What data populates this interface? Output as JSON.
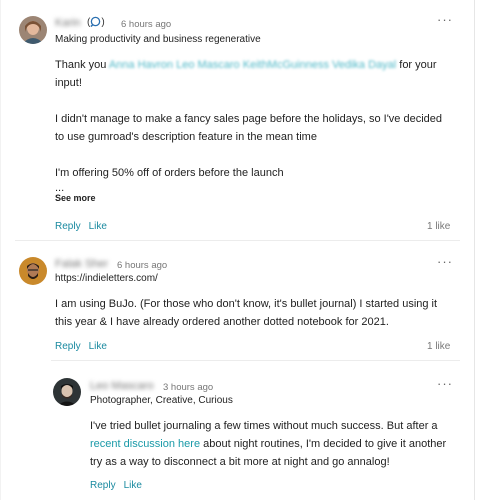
{
  "comments": [
    {
      "author": "Karin",
      "time": "6 hours ago",
      "tagline": "Making productivity and business regenerative",
      "body": {
        "p1_before": "Thank you ",
        "mentions": "Anna Havron Leo Mascaro KeithMcGuinness Vedika Dayal",
        "p1_after": " for your input!",
        "p2": "I didn't manage to make a fancy sales page before the holidays, so I've decided to use gumroad's description feature in the mean time",
        "p3": "I'm offering 50% off of orders before the launch",
        "ellipsis": "..."
      },
      "see_more": "See more",
      "reply": "Reply",
      "like": "Like",
      "likes": "1 like"
    },
    {
      "author": "Falak Sher",
      "time": "6 hours ago",
      "tagline": "https://indieletters.com/",
      "body": {
        "p1": "I am using BuJo. (For those who don't know, it's bullet journal) I started using it this year & I have already ordered another dotted notebook for 2021."
      },
      "reply": "Reply",
      "like": "Like",
      "likes": "1 like"
    },
    {
      "author": "Leo Mascaro",
      "time": "3 hours ago",
      "tagline": "Photographer, Creative, Curious",
      "body": {
        "p1_before": "I've tried bullet journaling a few times without much success. But after a ",
        "link": "recent discussion here",
        "p1_after": " about night routines, I'm decided to give it another try as a way to disconnect a bit more at night and go annalog!"
      },
      "reply": "Reply",
      "like": "Like"
    }
  ],
  "more_icon": "···",
  "colors": {
    "link": "#1a9aa8",
    "action": "#1a8aa0",
    "muted": "#777777"
  }
}
